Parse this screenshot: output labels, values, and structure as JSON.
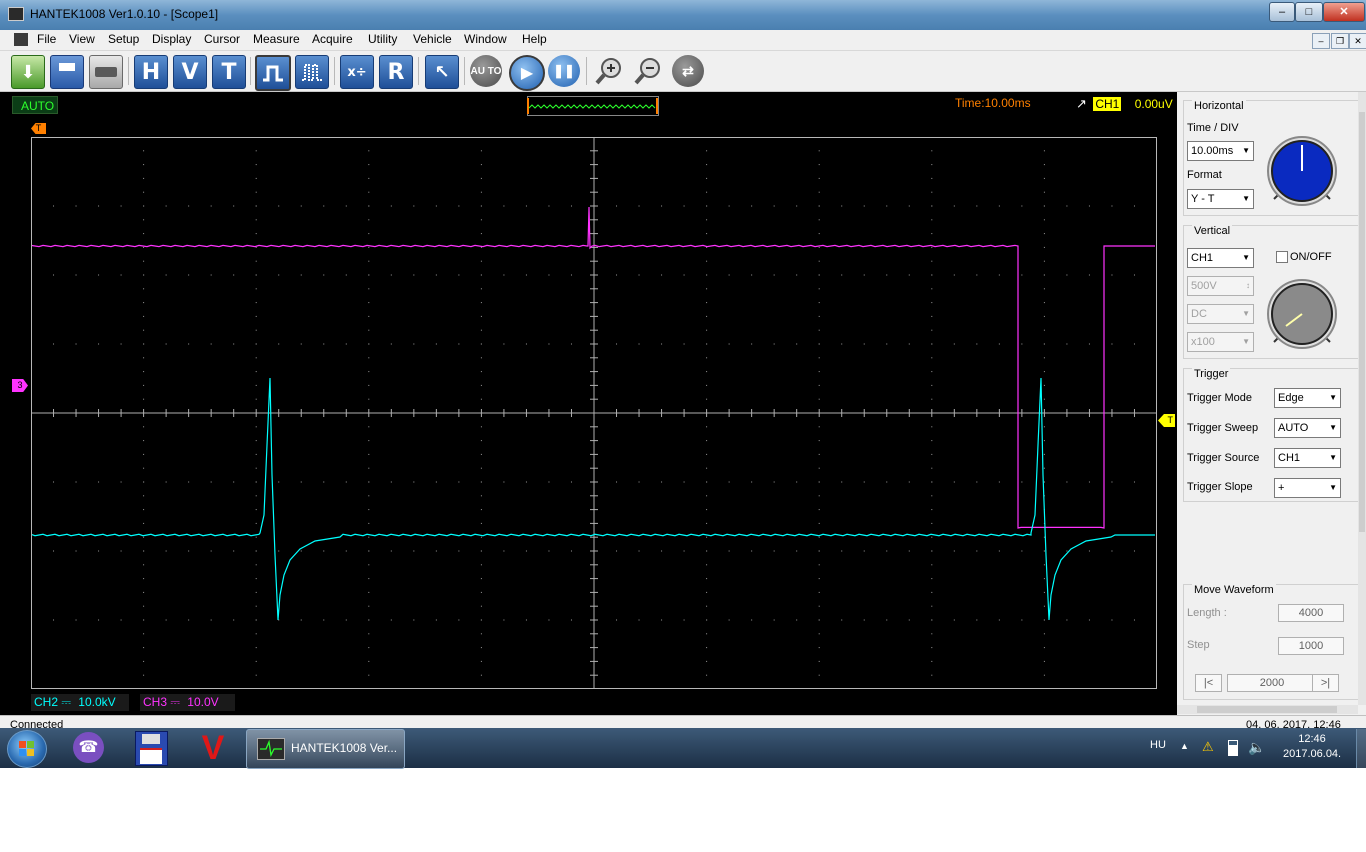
{
  "window": {
    "title": "HANTEK1008 Ver1.0.10 - [Scope1]"
  },
  "menu": [
    "File",
    "View",
    "Setup",
    "Display",
    "Cursor",
    "Measure",
    "Acquire",
    "Utility",
    "Vehicle",
    "Window",
    "Help"
  ],
  "toolbar": {
    "icons": [
      "open-icon",
      "save-icon",
      "print-icon",
      "horizontal-icon",
      "vertical-icon",
      "trigger-icon",
      "square-wave-icon",
      "pulse-wave-icon",
      "math-icon",
      "reference-icon",
      "cursor-select-icon",
      "auto-icon",
      "run-icon",
      "pause-icon",
      "zoom-in-icon",
      "zoom-out-icon",
      "fit-icon"
    ],
    "labels": {
      "horizontal": "H",
      "vertical": "V",
      "trigger": "T",
      "reference": "R",
      "auto": "AU TO"
    }
  },
  "scope": {
    "mode": "AUTO",
    "time_label": "Time:",
    "time_value": "10.00ms",
    "trigger_channel": "CH1",
    "trigger_level": "0.00uV",
    "ch2_label": "CH2",
    "ch2_coupling": "⎓",
    "ch2_scale": "10.0kV",
    "ch3_label": "CH3",
    "ch3_coupling": "⎓",
    "ch3_scale": "10.0V",
    "ch3_marker": "3",
    "trigger_marker": "T",
    "top_marker": "T",
    "colors": {
      "ch2": "#00ffff",
      "ch3": "#ff33ff",
      "timebase": "#ff8000",
      "mode": "#2cff2c"
    }
  },
  "horizontal": {
    "title": "Horizontal",
    "time_div_label": "Time / DIV",
    "time_div_value": "10.00ms",
    "format_label": "Format",
    "format_value": "Y - T"
  },
  "vertical": {
    "title": "Vertical",
    "channel": "CH1",
    "onoff_label": "ON/OFF",
    "onoff_checked": false,
    "volts": "500V",
    "coupling": "DC",
    "probe": "x100"
  },
  "trigger": {
    "title": "Trigger",
    "mode_label": "Trigger Mode",
    "mode_value": "Edge",
    "sweep_label": "Trigger Sweep",
    "sweep_value": "AUTO",
    "source_label": "Trigger Source",
    "source_value": "CH1",
    "slope_label": "Trigger Slope",
    "slope_value": "+"
  },
  "move_waveform": {
    "title": "Move Waveform",
    "length_label": "Length :",
    "length_value": "4000",
    "step_label": "Step",
    "step_value": "1000",
    "position_value": "2000",
    "first_btn": "|<",
    "last_btn": ">|"
  },
  "statusbar": {
    "left": "Connected",
    "right": "04. 06. 2017. 12:46"
  },
  "taskbar": {
    "task_label": "HANTEK1008 Ver...",
    "language": "HU",
    "time": "12:46",
    "date": "2017.06.04."
  }
}
